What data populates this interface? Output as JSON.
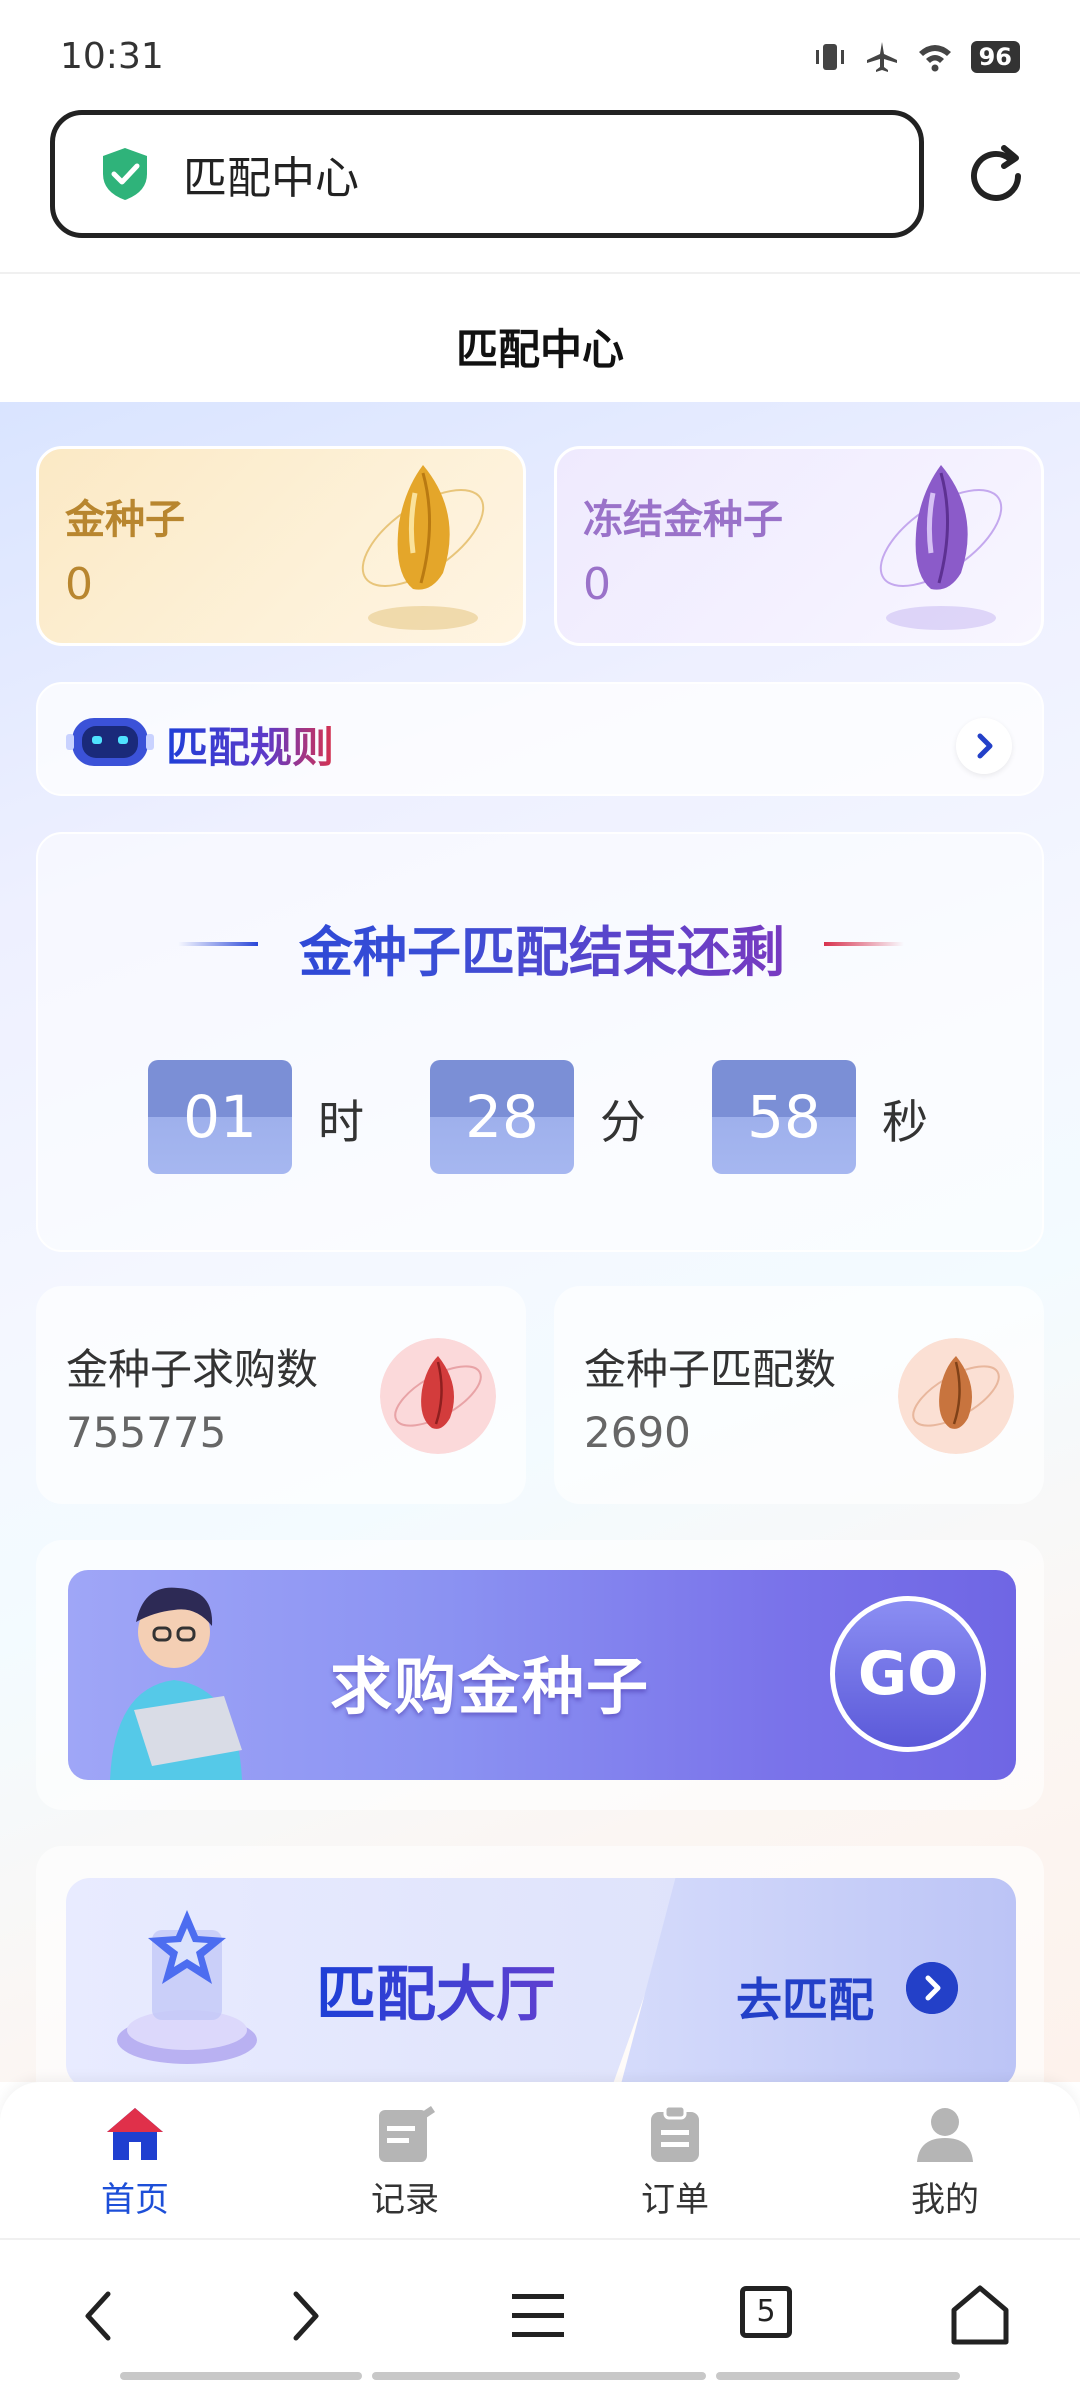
{
  "status_bar": {
    "time": "10:31",
    "battery": "96"
  },
  "browser": {
    "address_text": "匹配中心",
    "tab_count": "5"
  },
  "page": {
    "title": "匹配中心"
  },
  "seeds": {
    "gold": {
      "label": "金种子",
      "value": "0"
    },
    "frozen": {
      "label": "冻结金种子",
      "value": "0"
    }
  },
  "rules": {
    "label": "匹配规则"
  },
  "countdown": {
    "title": "金种子匹配结束还剩",
    "hours": "01",
    "hours_unit": "时",
    "minutes": "28",
    "minutes_unit": "分",
    "seconds": "58",
    "seconds_unit": "秒"
  },
  "stats": {
    "purchase": {
      "label": "金种子求购数",
      "value": "755775"
    },
    "matched": {
      "label": "金种子匹配数",
      "value": "2690"
    }
  },
  "buy_banner": {
    "text": "求购金种子",
    "go": "GO"
  },
  "hall": {
    "title": "匹配大厅",
    "action": "去匹配"
  },
  "tabs": [
    {
      "label": "首页"
    },
    {
      "label": "记录"
    },
    {
      "label": "订单"
    },
    {
      "label": "我的"
    }
  ],
  "colors": {
    "accent": "#1d4fd8",
    "gold": "#b8862f",
    "purple": "#9a72c9"
  }
}
